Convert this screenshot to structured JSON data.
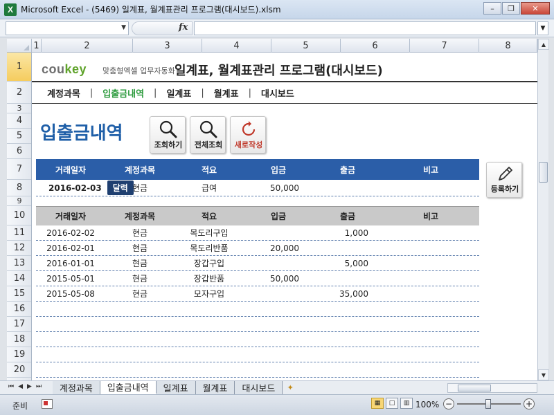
{
  "window": {
    "title": "Microsoft Excel - (5469) 일계표, 월계표관리 프로그램(대시보드).xlsm",
    "logo_letter": "X"
  },
  "formula": {
    "fx": "fx"
  },
  "columns": [
    "1",
    "2",
    "3",
    "4",
    "5",
    "6",
    "7",
    "8"
  ],
  "rows": [
    "1",
    "2",
    "3",
    "4",
    "5",
    "6",
    "7",
    "8",
    "9",
    "10",
    "11",
    "12",
    "13",
    "14",
    "15",
    "16",
    "17",
    "18",
    "19",
    "20"
  ],
  "brand": {
    "cou": "cou",
    "key": "key",
    "tagline": "맞춤형엑셀 업무자동화"
  },
  "app_title": "일계표, 월계표관리 프로그램(대시보드)",
  "nav": [
    "계정과목",
    "입출금내역",
    "일계표",
    "월계표",
    "대시보드"
  ],
  "section_title": "입출금내역",
  "buttons": {
    "search": "조회하기",
    "search_all": "전체조회",
    "new": "새로작성",
    "register": "등록하기",
    "calendar": "달력"
  },
  "headers": [
    "거래일자",
    "계정과목",
    "적요",
    "입금",
    "출금",
    "비고"
  ],
  "input_row": {
    "date": "2016-02-03",
    "account": "현금",
    "desc": "급여",
    "deposit": "50,000",
    "withdraw": "",
    "note": ""
  },
  "records": [
    {
      "date": "2016-02-02",
      "account": "현금",
      "desc": "목도리구입",
      "deposit": "",
      "withdraw": "1,000",
      "note": ""
    },
    {
      "date": "2016-02-01",
      "account": "현금",
      "desc": "목도리반품",
      "deposit": "20,000",
      "withdraw": "",
      "note": ""
    },
    {
      "date": "2016-01-01",
      "account": "현금",
      "desc": "장갑구입",
      "deposit": "",
      "withdraw": "5,000",
      "note": ""
    },
    {
      "date": "2015-05-01",
      "account": "현금",
      "desc": "장갑반품",
      "deposit": "50,000",
      "withdraw": "",
      "note": ""
    },
    {
      "date": "2015-05-08",
      "account": "현금",
      "desc": "모자구입",
      "deposit": "",
      "withdraw": "35,000",
      "note": ""
    }
  ],
  "sheet_tabs": [
    "계정과목",
    "입출금내역",
    "일계표",
    "월계표",
    "대시보드"
  ],
  "active_tab": 1,
  "status": {
    "ready": "준비",
    "zoom": "100%"
  },
  "colors": {
    "accent_blue": "#2b5ea8",
    "active_green": "#2b9a3c",
    "title_blue": "#1f5fa8"
  }
}
